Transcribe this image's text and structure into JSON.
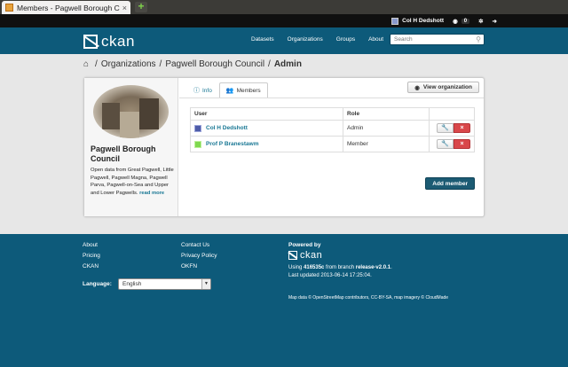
{
  "browser": {
    "tab_title": "Members - Pagwell Borough C...",
    "tab_close": "×",
    "new_tab": "+"
  },
  "account": {
    "user_name": "Col H Dedshott",
    "dashboard_count": "0",
    "dashboard_icon": "dashboard-icon",
    "settings_icon": "gear-icon",
    "logout_icon": "logout-icon"
  },
  "masthead": {
    "logo_text": "ckan",
    "nav": [
      "Datasets",
      "Organizations",
      "Groups",
      "About"
    ],
    "search_placeholder": "Search"
  },
  "breadcrumb": {
    "sep": "/",
    "organizations": "Organizations",
    "org": "Pagwell Borough Council",
    "current": "Admin"
  },
  "sidebar": {
    "title": "Pagwell Borough Council",
    "description": "Open data from Great Pagwell, Little Pagwell, Pagwell Magna, Pagwell Parva, Pagwell-on-Sea and Upper and Lower Pagwells.",
    "read_more": "read more"
  },
  "tabs": {
    "info": "Info",
    "members": "Members"
  },
  "view_org_label": "View organization",
  "table": {
    "headers": [
      "User",
      "Role",
      ""
    ],
    "rows": [
      {
        "user": "Col H Dedshott",
        "role": "Admin",
        "edit_icon": "wrench-icon",
        "delete_label": "×"
      },
      {
        "user": "Prof P Branestawm",
        "role": "Member",
        "edit_icon": "wrench-icon",
        "delete_label": "×"
      }
    ]
  },
  "add_member_label": "Add member",
  "footer": {
    "col1": [
      "About",
      "Pricing",
      "CKAN"
    ],
    "col2": [
      "Contact Us",
      "Privacy Policy",
      "OKFN"
    ],
    "language_label": "Language:",
    "language_value": "English",
    "powered_by": "Powered by",
    "logo_text": "ckan",
    "build_prefix": "Using",
    "build_hash": "416535c",
    "build_middle": "from branch",
    "build_branch": "release-v2.0.1",
    "build_suffix": ".",
    "last_updated": "Last updated 2013-06-14 17:25:04.",
    "map_credit": "Map data © OpenStreetMap contributors, CC-BY-SA, map imagery © CloudMade"
  },
  "colors": {
    "brand": "#0d5a7a",
    "link": "#187794",
    "danger": "#d9474a",
    "primary_button": "#1c5b73"
  }
}
